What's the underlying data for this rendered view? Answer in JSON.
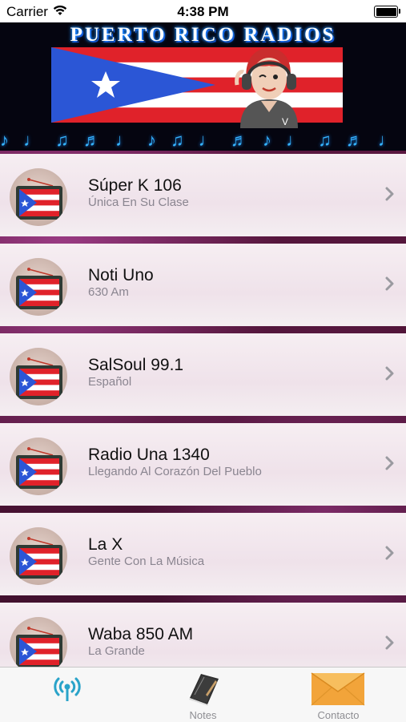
{
  "status_bar": {
    "carrier": "Carrier",
    "time": "4:38 PM"
  },
  "banner": {
    "title": "PUERTO RICO RADIOS"
  },
  "stations": [
    {
      "name": "Súper K 106",
      "tagline": "Única En Su Clase"
    },
    {
      "name": "Noti Uno",
      "tagline": "630 Am"
    },
    {
      "name": "SalSoul 99.1",
      "tagline": "Español"
    },
    {
      "name": "Radio Una 1340",
      "tagline": "Llegando Al Corazón Del Pueblo"
    },
    {
      "name": "La X",
      "tagline": "Gente Con La Música"
    },
    {
      "name": "Waba 850 AM",
      "tagline": "La Grande"
    }
  ],
  "tab_bar": {
    "tabs": [
      {
        "label": "",
        "icon": "radio-antenna-icon",
        "selected": true
      },
      {
        "label": "Notes",
        "icon": "notebook-icon",
        "selected": false
      },
      {
        "label": "Contacto",
        "icon": "envelope-icon",
        "selected": false
      }
    ]
  },
  "colors": {
    "accent": "#2aa3c9",
    "list_separator": "#5a173f",
    "flag_red": "#e0222a",
    "flag_blue": "#2b56d6"
  }
}
